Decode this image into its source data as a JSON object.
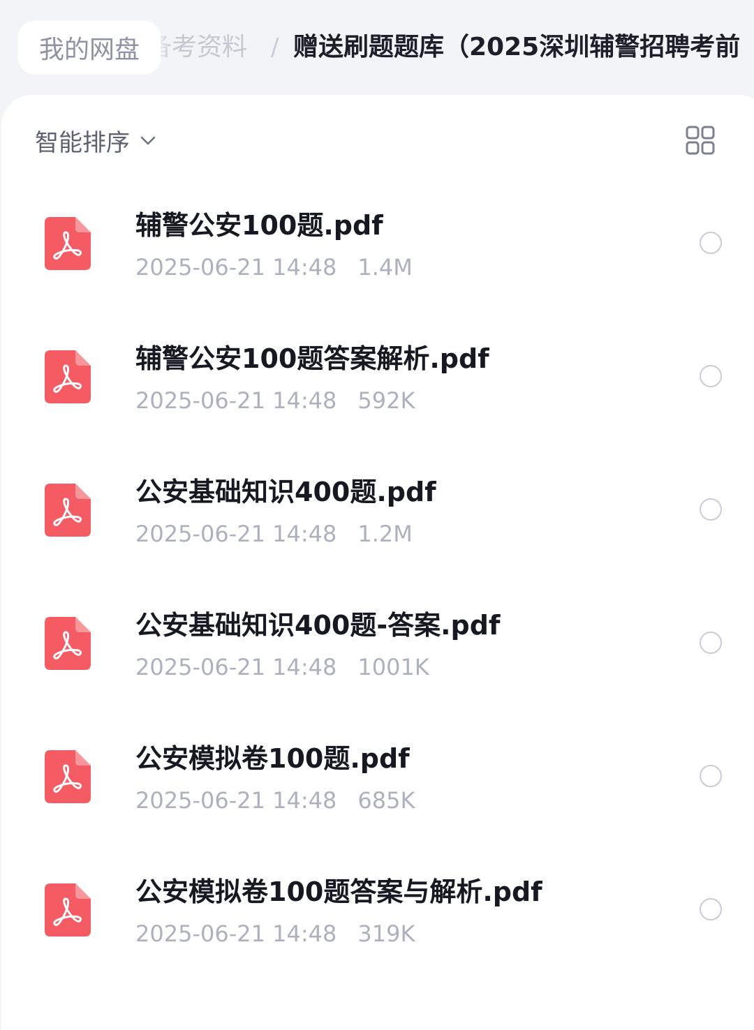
{
  "breadcrumb": {
    "home": "我的网盘",
    "parent": "备考资料",
    "separator": "/",
    "current": "赠送刷题题库（2025深圳辅警招聘考前"
  },
  "toolbar": {
    "sort_label": "智能排序",
    "sort_icon": "chevron-down-icon",
    "view_icon": "grid-view-icon"
  },
  "colors": {
    "pdf_icon": "#f45b63",
    "background": "#f3f4f8",
    "card": "#ffffff",
    "meta_text": "#adb1bd"
  },
  "files": [
    {
      "name": "辅警公安100题.pdf",
      "date": "2025-06-21 14:48",
      "size": "1.4M",
      "icon": "pdf-icon",
      "selected": false
    },
    {
      "name": "辅警公安100题答案解析.pdf",
      "date": "2025-06-21 14:48",
      "size": "592K",
      "icon": "pdf-icon",
      "selected": false
    },
    {
      "name": "公安基础知识400题.pdf",
      "date": "2025-06-21 14:48",
      "size": "1.2M",
      "icon": "pdf-icon",
      "selected": false
    },
    {
      "name": "公安基础知识400题-答案.pdf",
      "date": "2025-06-21 14:48",
      "size": "1001K",
      "icon": "pdf-icon",
      "selected": false
    },
    {
      "name": "公安模拟卷100题.pdf",
      "date": "2025-06-21 14:48",
      "size": "685K",
      "icon": "pdf-icon",
      "selected": false
    },
    {
      "name": "公安模拟卷100题答案与解析.pdf",
      "date": "2025-06-21 14:48",
      "size": "319K",
      "icon": "pdf-icon",
      "selected": false
    }
  ]
}
